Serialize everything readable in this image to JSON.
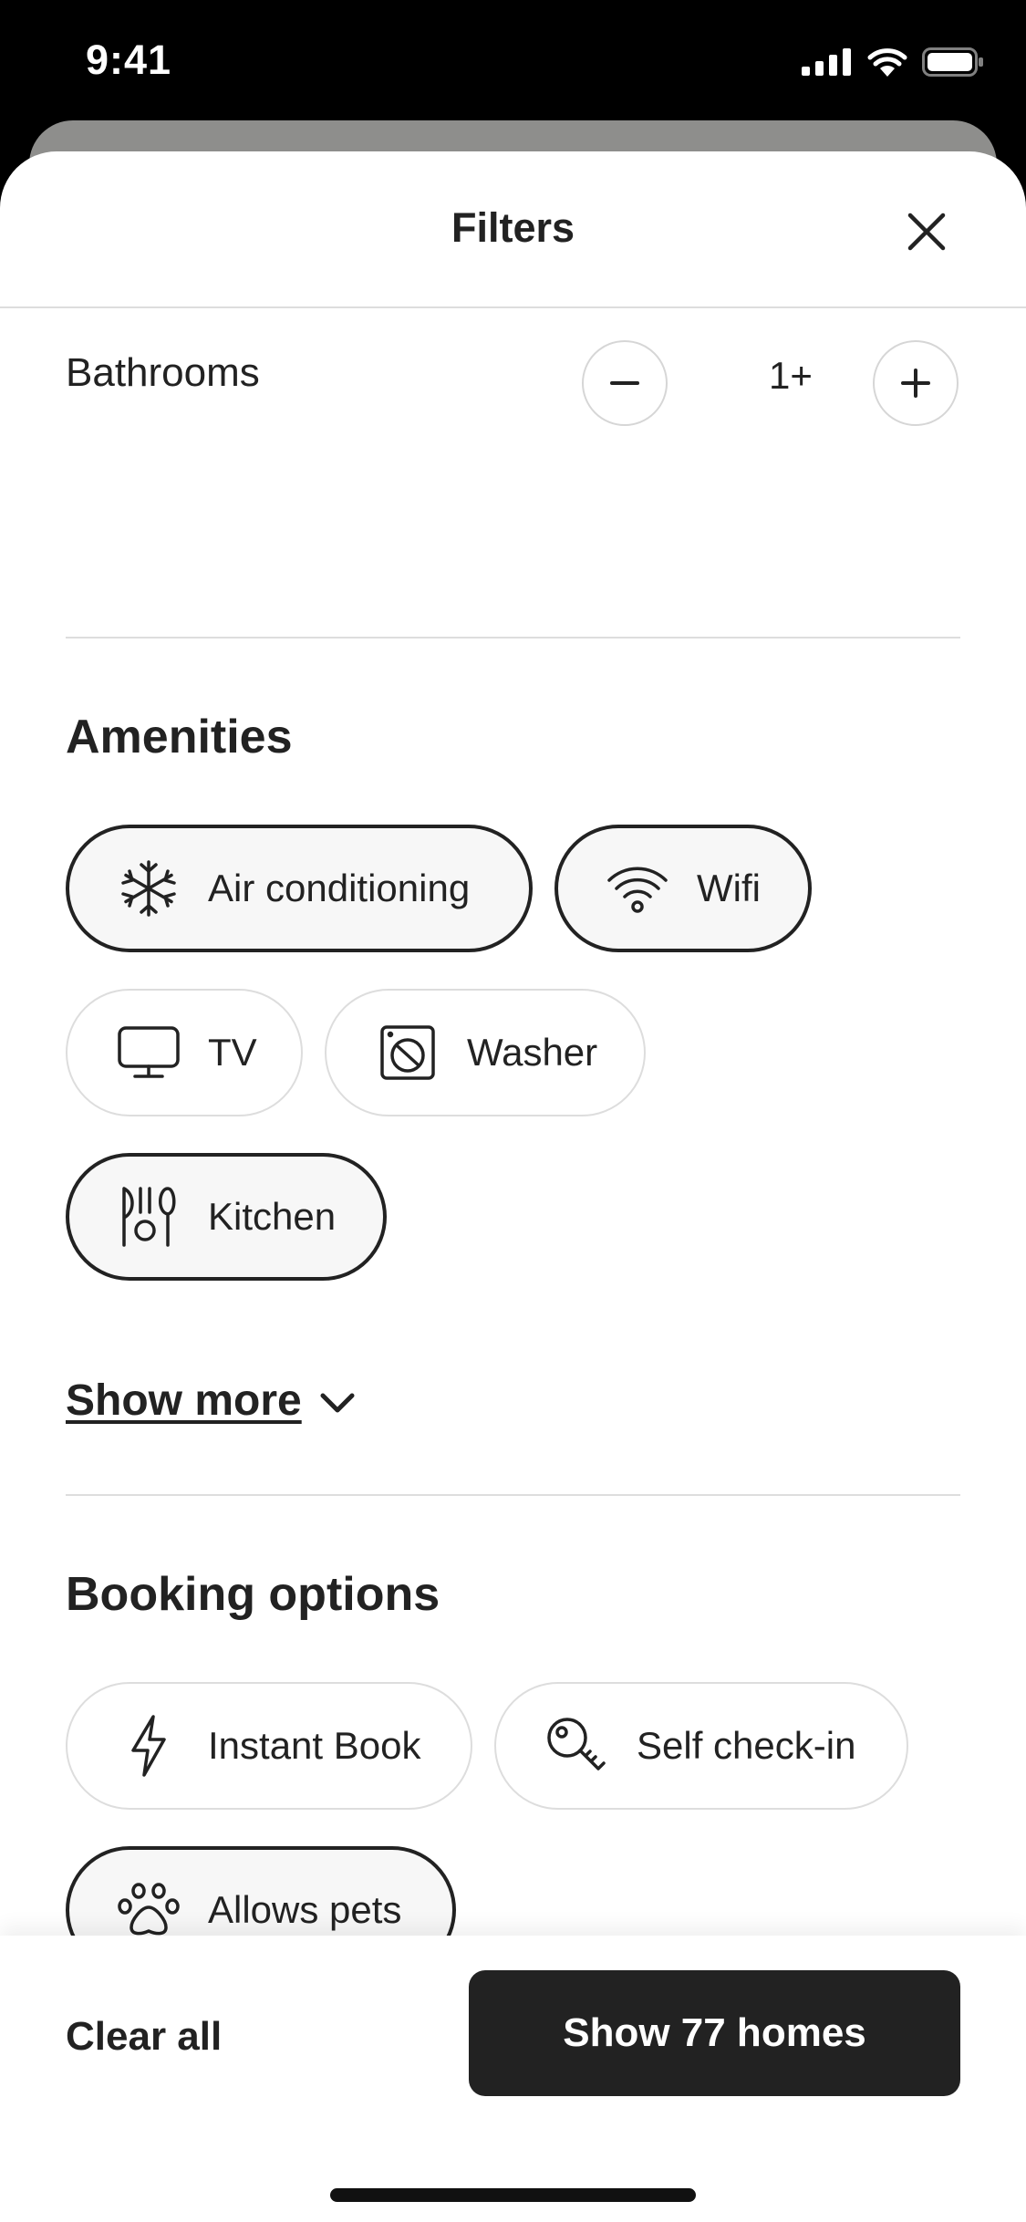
{
  "status_bar": {
    "time": "9:41"
  },
  "header": {
    "title": "Filters"
  },
  "bathrooms": {
    "label": "Bathrooms",
    "value": "1+"
  },
  "amenities": {
    "title": "Amenities",
    "chips": [
      {
        "label": "Air conditioning",
        "icon": "snowflake-icon",
        "selected": true
      },
      {
        "label": "Wifi",
        "icon": "wifi-icon",
        "selected": true
      },
      {
        "label": "TV",
        "icon": "tv-icon",
        "selected": false
      },
      {
        "label": "Washer",
        "icon": "washer-icon",
        "selected": false
      },
      {
        "label": "Kitchen",
        "icon": "kitchen-icon",
        "selected": true
      }
    ],
    "show_more": "Show more"
  },
  "booking": {
    "title": "Booking options",
    "chips": [
      {
        "label": "Instant Book",
        "icon": "lightning-icon",
        "selected": false
      },
      {
        "label": "Self check-in",
        "icon": "key-icon",
        "selected": false
      },
      {
        "label": "Allows pets",
        "icon": "paw-icon",
        "selected": true
      }
    ]
  },
  "footer": {
    "clear_all": "Clear all",
    "show_button": "Show 77 homes"
  },
  "colors": {
    "text": "#222222",
    "divider": "#dddddd",
    "button": "#222222",
    "selected_bg": "#f7f7f7"
  }
}
